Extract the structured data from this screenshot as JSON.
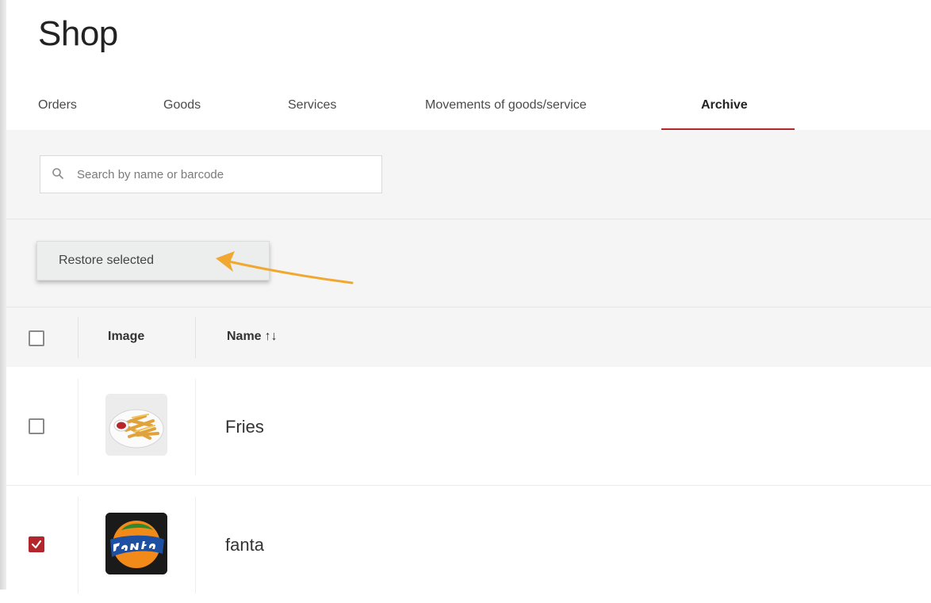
{
  "page": {
    "title": "Shop"
  },
  "tabs": [
    {
      "label": "Orders",
      "active": false
    },
    {
      "label": "Goods",
      "active": false
    },
    {
      "label": "Services",
      "active": false
    },
    {
      "label": "Movements of goods/service",
      "active": false
    },
    {
      "label": "Archive",
      "active": true
    }
  ],
  "search": {
    "placeholder": "Search by name or barcode",
    "value": ""
  },
  "actions": {
    "restore_label": "Restore selected"
  },
  "annotation": {
    "arrow_color": "#f0a830"
  },
  "table": {
    "headers": {
      "image": "Image",
      "name": "Name",
      "sort_icon": "↑↓"
    },
    "rows": [
      {
        "name": "Fries",
        "checked": false,
        "image_icon": "fries-image"
      },
      {
        "name": "fanta",
        "checked": true,
        "image_icon": "fanta-logo-image"
      }
    ]
  },
  "colors": {
    "accent": "#b3262c",
    "background": "#f5f5f5"
  }
}
